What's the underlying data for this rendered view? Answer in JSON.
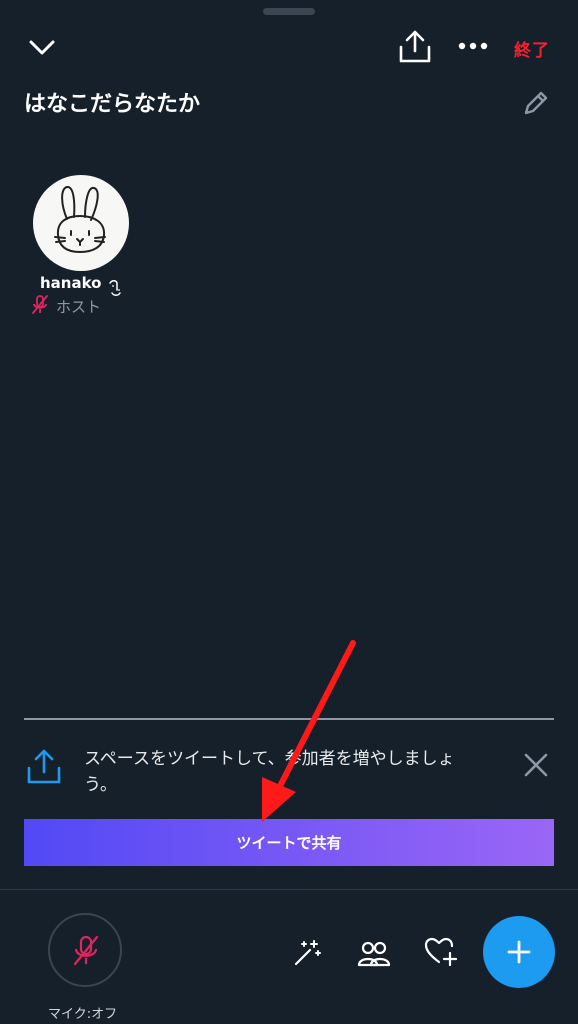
{
  "header": {
    "end_label": "終了",
    "space_title": "はなこだらなたか"
  },
  "participants": [
    {
      "name": "hanako",
      "role": "ホスト",
      "mic": "muted"
    }
  ],
  "share_prompt": {
    "message": "スペースをツイートして、参加者を増やしましょう。",
    "button_label": "ツイートで共有"
  },
  "bottom_bar": {
    "mic_label": "マイク:オフ"
  },
  "colors": {
    "background": "#16202b",
    "end_red": "#f4212e",
    "accent_blue": "#1d9bf0",
    "muted_pink": "#e0245e",
    "gradient_start": "#5249f5",
    "gradient_end": "#9a66f6"
  }
}
